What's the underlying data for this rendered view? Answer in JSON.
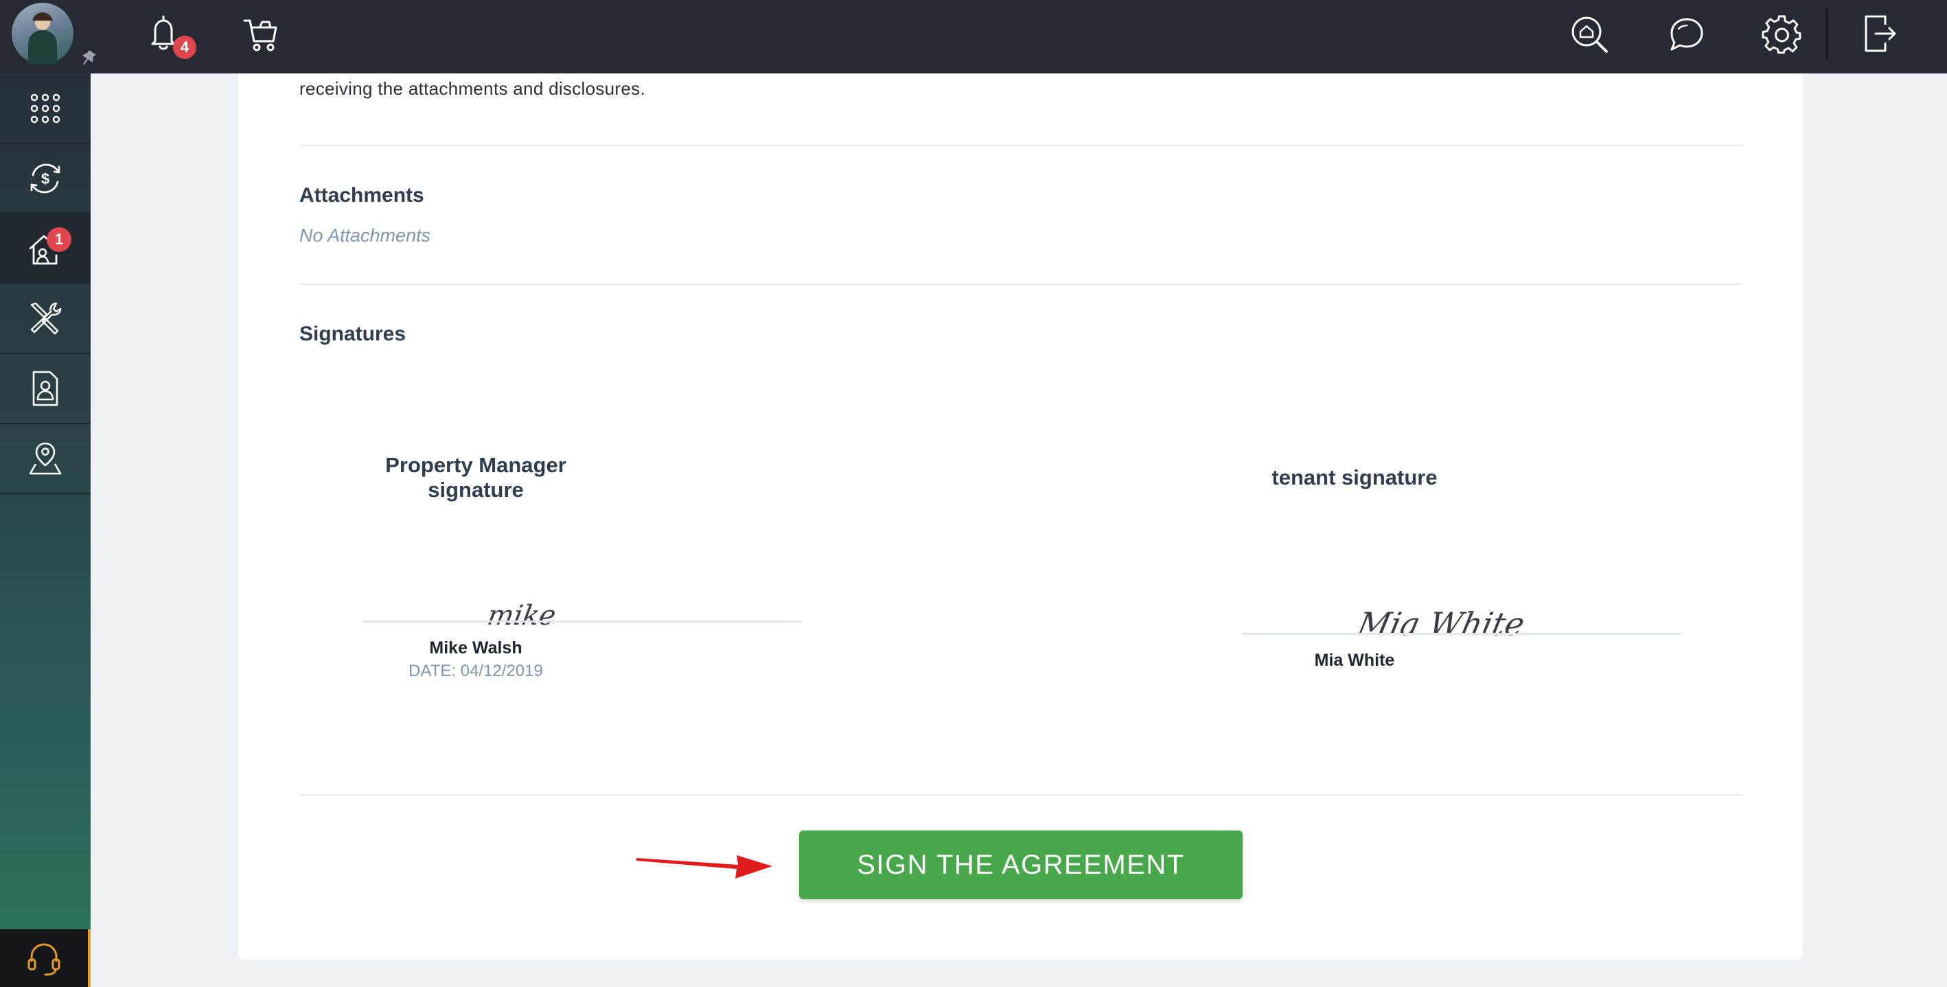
{
  "topbar": {
    "notifications_count": "4",
    "icons": [
      "bell-icon",
      "cart-icon",
      "home-search-icon",
      "chat-icon",
      "gear-icon",
      "logout-icon"
    ]
  },
  "sidebar": {
    "items": [
      {
        "icon": "apps-grid-icon"
      },
      {
        "icon": "payments-icon"
      },
      {
        "icon": "rentals-icon",
        "badge": "1",
        "active": true
      },
      {
        "icon": "maintenance-icon"
      },
      {
        "icon": "tenant-profile-icon"
      },
      {
        "icon": "location-user-icon"
      }
    ],
    "support_icon": "headset-icon"
  },
  "content": {
    "intro_text": "receiving the attachments and disclosures.",
    "attachments": {
      "title": "Attachments",
      "empty_text": "No Attachments"
    },
    "signatures": {
      "title": "Signatures",
      "manager": {
        "label": "Property Manager signature",
        "signature_text": "mike",
        "name": "Mike Walsh",
        "date": "DATE: 04/12/2019"
      },
      "tenant": {
        "label": "tenant signature",
        "signature_text": "Mia White",
        "name": "Mia White"
      }
    },
    "sign_button_label": "SIGN THE AGREEMENT"
  },
  "colors": {
    "topbar_bg": "#262a33",
    "accent_green": "#47a74a",
    "badge_red": "#e0474c",
    "arrow_red": "#e01b1b"
  }
}
